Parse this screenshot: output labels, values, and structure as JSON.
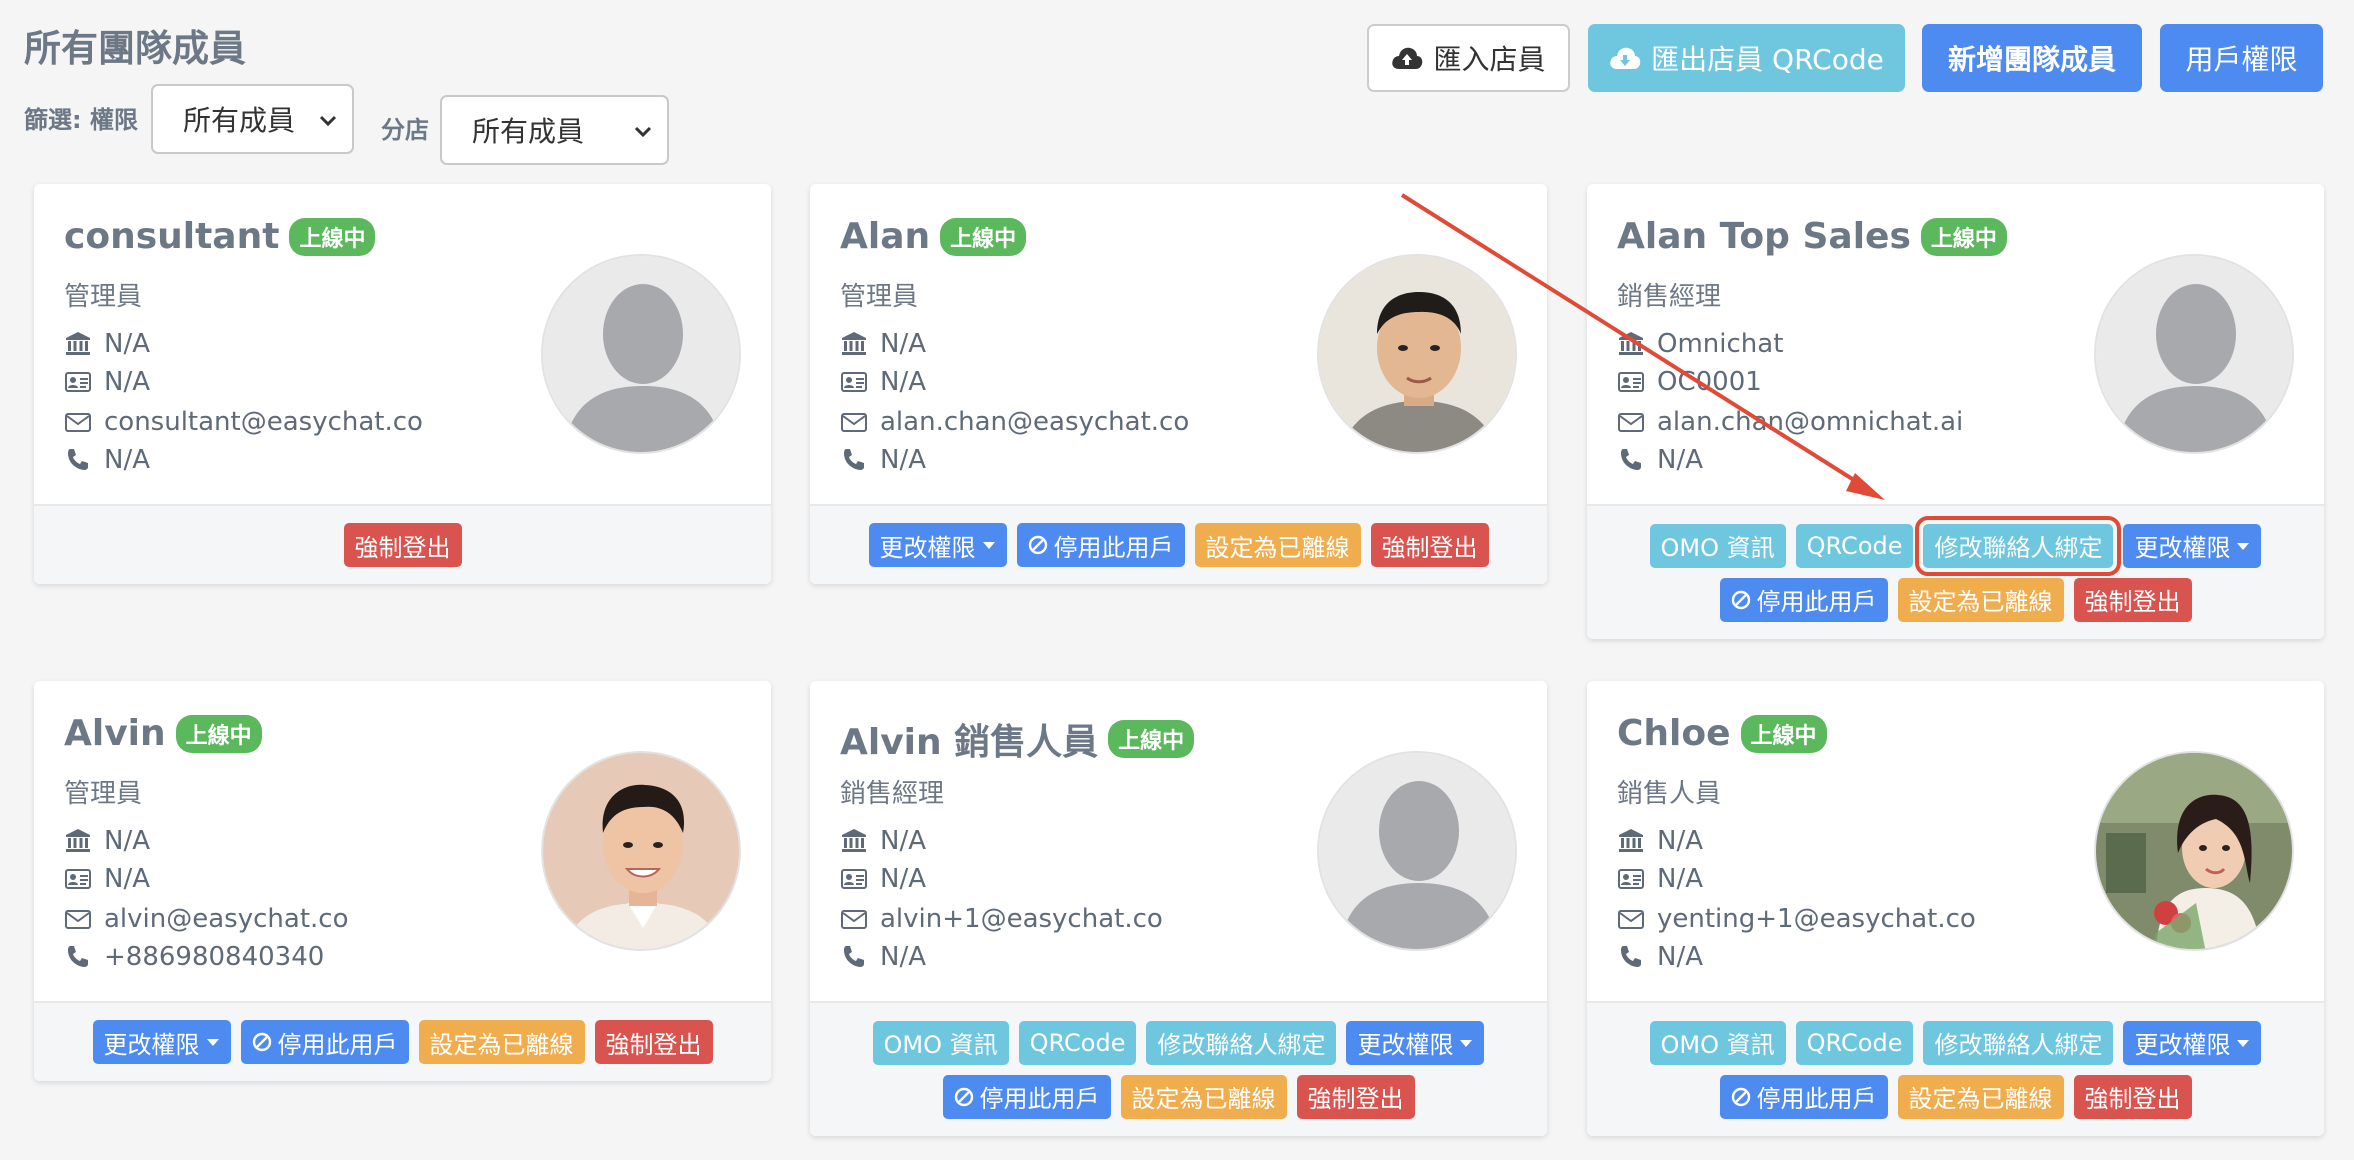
{
  "page": {
    "title": "所有團隊成員"
  },
  "filters": {
    "role_label": "篩選: 權限",
    "role_value": "所有成員",
    "branch_label": "分店",
    "branch_value": "所有成員"
  },
  "toolbar": {
    "import_label": "匯入店員",
    "export_label": "匯出店員 QRCode",
    "add_label": "新增團隊成員",
    "perm_label": "用戶權限"
  },
  "labels": {
    "online": "上線中",
    "omo": "OMO 資訊",
    "qrcode": "QRCode",
    "bind": "修改聯絡人綁定",
    "change_perm": "更改權限",
    "disable": "停用此用戶",
    "set_offline": "設定為已離線",
    "force_logout": "強制登出"
  },
  "members": [
    {
      "name": "consultant",
      "role": "管理員",
      "branch": "N/A",
      "id": "N/A",
      "email": "consultant@easychat.co",
      "phone": "N/A",
      "avatar": "placeholder"
    },
    {
      "name": "Alan",
      "role": "管理員",
      "branch": "N/A",
      "id": "N/A",
      "email": "alan.chan@easychat.co",
      "phone": "N/A",
      "avatar": "photo-man-glasses"
    },
    {
      "name": "Alan Top Sales",
      "role": "銷售經理",
      "branch": "Omnichat",
      "id": "OC0001",
      "email": "alan.chan@omnichat.ai",
      "phone": "N/A",
      "avatar": "placeholder"
    },
    {
      "name": "Alvin",
      "role": "管理員",
      "branch": "N/A",
      "id": "N/A",
      "email": "alvin@easychat.co",
      "phone": "+886980840340",
      "avatar": "photo-man-smiling"
    },
    {
      "name": "Alvin 銷售人員",
      "role": "銷售經理",
      "branch": "N/A",
      "id": "N/A",
      "email": "alvin+1@easychat.co",
      "phone": "N/A",
      "avatar": "placeholder"
    },
    {
      "name": "Chloe",
      "role": "銷售人員",
      "branch": "N/A",
      "id": "N/A",
      "email": "yenting+1@easychat.co",
      "phone": "N/A",
      "avatar": "photo-woman-flowers"
    }
  ],
  "annotation": {
    "color": "#e04b38",
    "target": "修改聯絡人綁定"
  }
}
